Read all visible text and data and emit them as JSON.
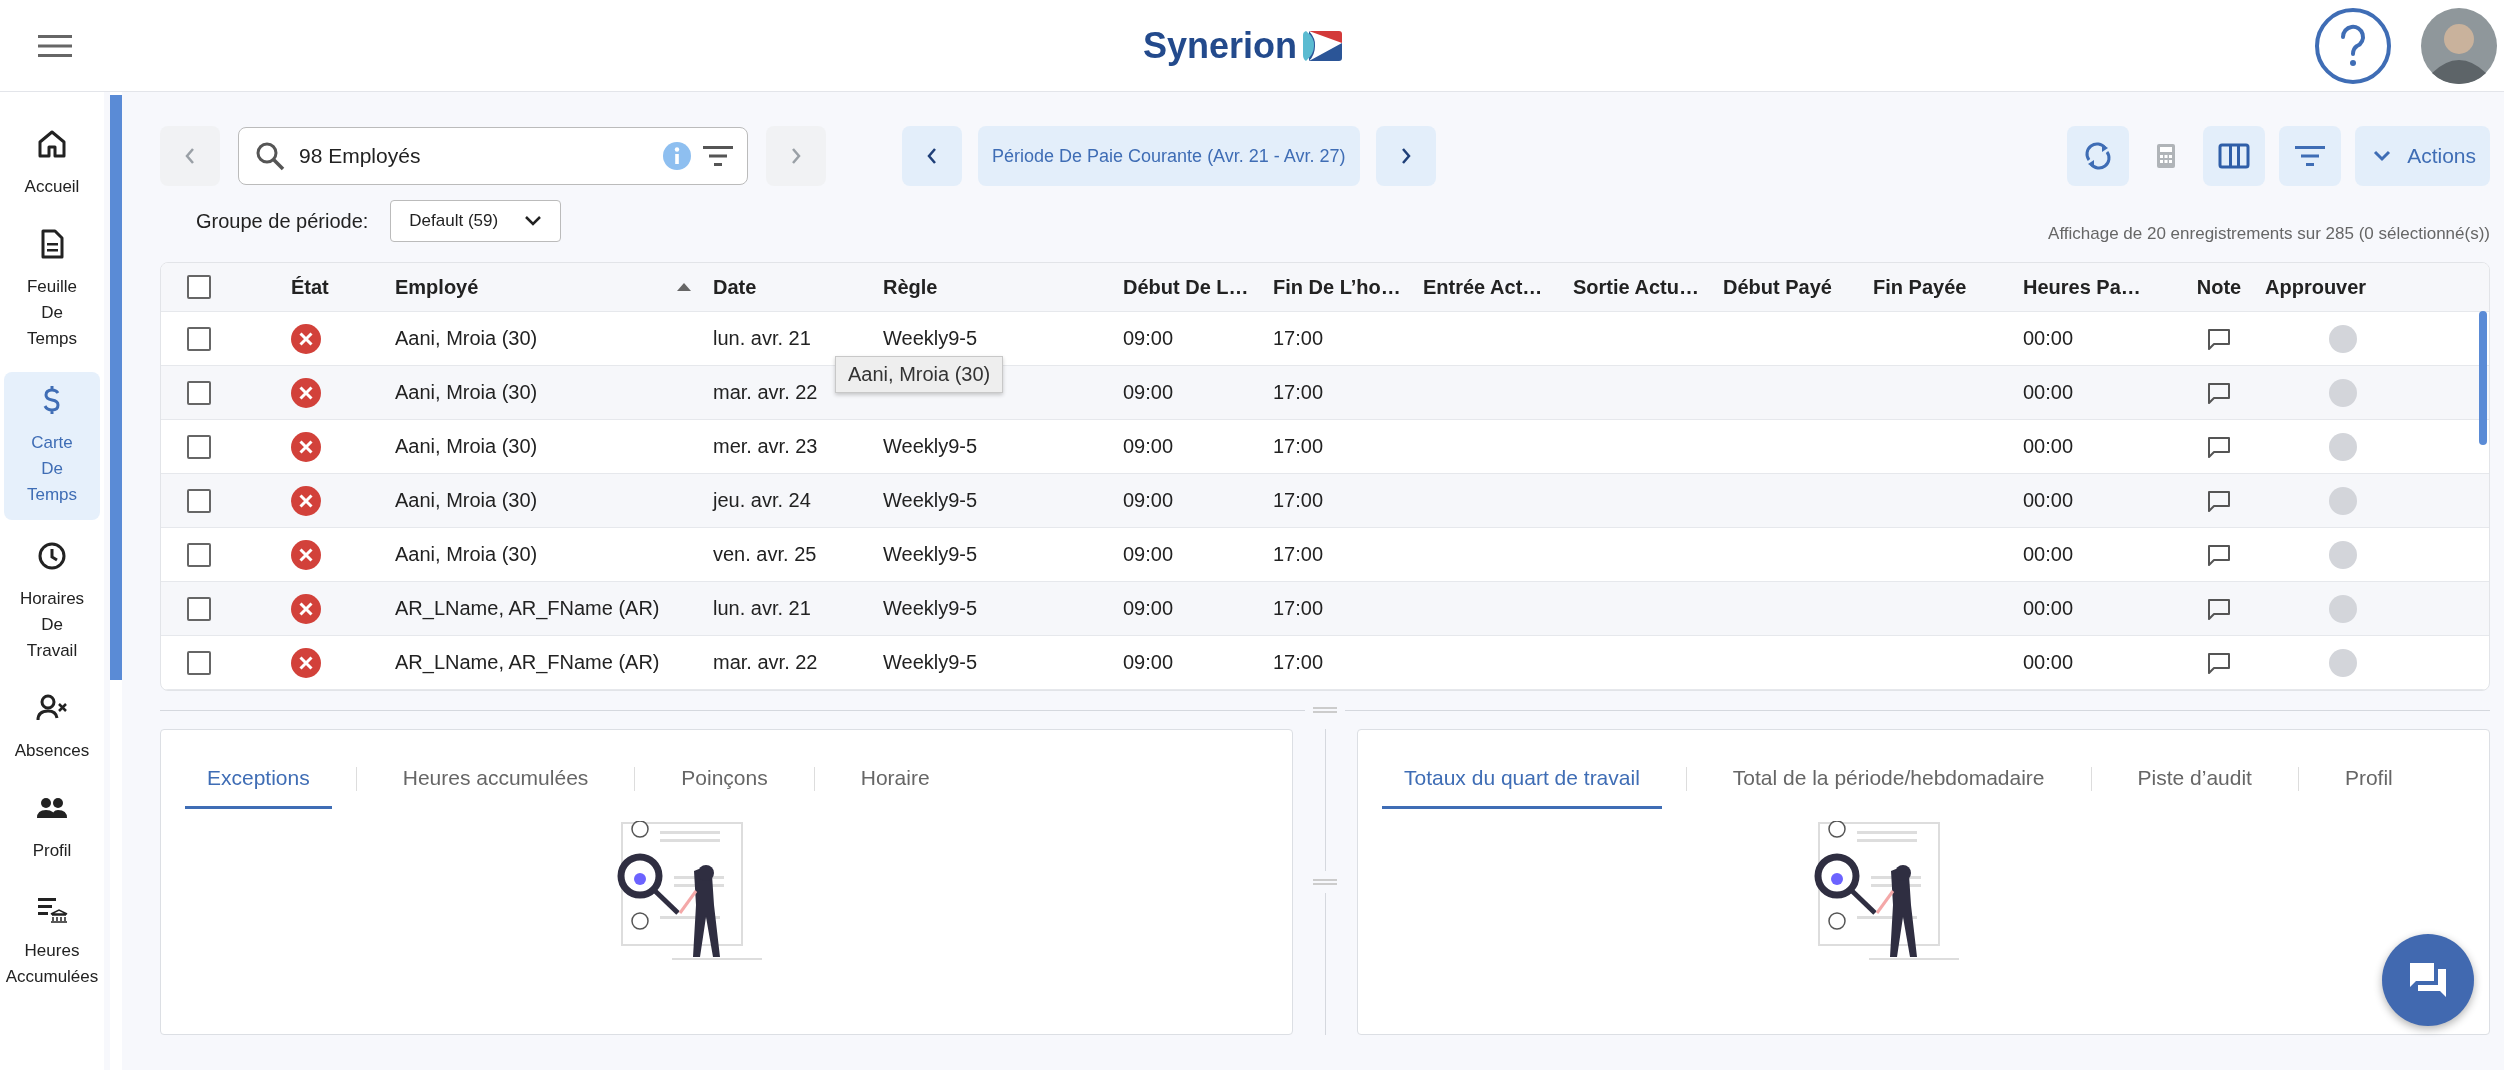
{
  "header": {
    "logo": "Synerion"
  },
  "sidebar": {
    "items": [
      {
        "kind": "home",
        "label": "Accueil",
        "selected": false
      },
      {
        "kind": "sheet",
        "label": "Feuille De Temps",
        "selected": false
      },
      {
        "kind": "dollar",
        "label": "Carte De Temps",
        "selected": true
      },
      {
        "kind": "clock",
        "label": "Horaires De Travail",
        "selected": false
      },
      {
        "kind": "absence",
        "label": "Absences",
        "selected": false
      },
      {
        "kind": "people",
        "label": "Profil",
        "selected": false
      },
      {
        "kind": "accrual",
        "label": "Heures Accumulées",
        "selected": false
      }
    ]
  },
  "toolbar": {
    "employee_search": {
      "value": "98 Employés"
    },
    "period": "Période De Paie Courante (Avr. 21 - Avr. 27)",
    "actions_label": "Actions",
    "calculator_disabled": true,
    "prev_disabled": true,
    "next_disabled": true
  },
  "period_group": {
    "label": "Groupe de période:",
    "value": "Default (59)"
  },
  "records_info": "Affichage de 20 enregistrements sur 285 (0 sélectionné(s))",
  "table": {
    "select_all_checked": false,
    "columns": [
      {
        "label": "État",
        "sorted": false
      },
      {
        "label": "Employé",
        "sorted": true
      },
      {
        "label": "Date",
        "sorted": false
      },
      {
        "label": "Règle",
        "sorted": false
      },
      {
        "label": "Début De L…",
        "sorted": false
      },
      {
        "label": "Fin De L’ho…",
        "sorted": false
      },
      {
        "label": "Entrée Act…",
        "sorted": false
      },
      {
        "label": "Sortie Actu…",
        "sorted": false
      },
      {
        "label": "Début Payé",
        "sorted": false
      },
      {
        "label": "Fin Payée",
        "sorted": false
      },
      {
        "label": "Heures Pa…",
        "sorted": false
      },
      {
        "label": "Note",
        "sorted": false
      },
      {
        "label": "Approuver",
        "sorted": false
      }
    ],
    "rows": [
      {
        "checked": false,
        "kind": "error",
        "employee": "Aani, Mroia (30)",
        "date": "lun. avr. 21",
        "rule": "Weekly9-5",
        "start": "09:00",
        "end": "17:00",
        "hours": "00:00",
        "approved": false
      },
      {
        "checked": false,
        "kind": "error",
        "employee": "Aani, Mroia (30)",
        "date": "mar. avr. 22",
        "start": "09:00",
        "end": "17:00",
        "hours": "00:00",
        "approved": false
      },
      {
        "checked": false,
        "kind": "error",
        "employee": "Aani, Mroia (30)",
        "date": "mer. avr. 23",
        "rule": "Weekly9-5",
        "start": "09:00",
        "end": "17:00",
        "hours": "00:00",
        "approved": false
      },
      {
        "checked": false,
        "kind": "error",
        "employee": "Aani, Mroia (30)",
        "date": "jeu. avr. 24",
        "rule": "Weekly9-5",
        "start": "09:00",
        "end": "17:00",
        "hours": "00:00",
        "approved": false
      },
      {
        "checked": false,
        "kind": "error",
        "employee": "Aani, Mroia (30)",
        "date": "ven. avr. 25",
        "rule": "Weekly9-5",
        "start": "09:00",
        "end": "17:00",
        "hours": "00:00",
        "approved": false
      },
      {
        "checked": false,
        "kind": "error",
        "employee": "AR_LName, AR_FName (AR)",
        "date": "lun. avr. 21",
        "rule": "Weekly9-5",
        "start": "09:00",
        "end": "17:00",
        "hours": "00:00",
        "approved": false
      },
      {
        "checked": false,
        "kind": "error",
        "employee": "AR_LName, AR_FName (AR)",
        "date": "mar. avr. 22",
        "rule": "Weekly9-5",
        "start": "09:00",
        "end": "17:00",
        "hours": "00:00",
        "approved": false
      }
    ]
  },
  "tooltip": {
    "text": "Aani, Mroia (30)"
  },
  "panels": [
    {
      "tabs": [
        {
          "label": "Exceptions",
          "selected": true
        },
        {
          "label": "Heures accumulées",
          "selected": false
        },
        {
          "label": "Poinçons",
          "selected": false
        },
        {
          "label": "Horaire",
          "selected": false
        }
      ]
    },
    {
      "tabs": [
        {
          "label": "Totaux du quart de travail",
          "selected": true
        },
        {
          "label": "Total de la période/hebdomadaire",
          "selected": false
        },
        {
          "label": "Piste d’audit",
          "selected": false
        },
        {
          "label": "Profil",
          "selected": false
        }
      ]
    }
  ]
}
